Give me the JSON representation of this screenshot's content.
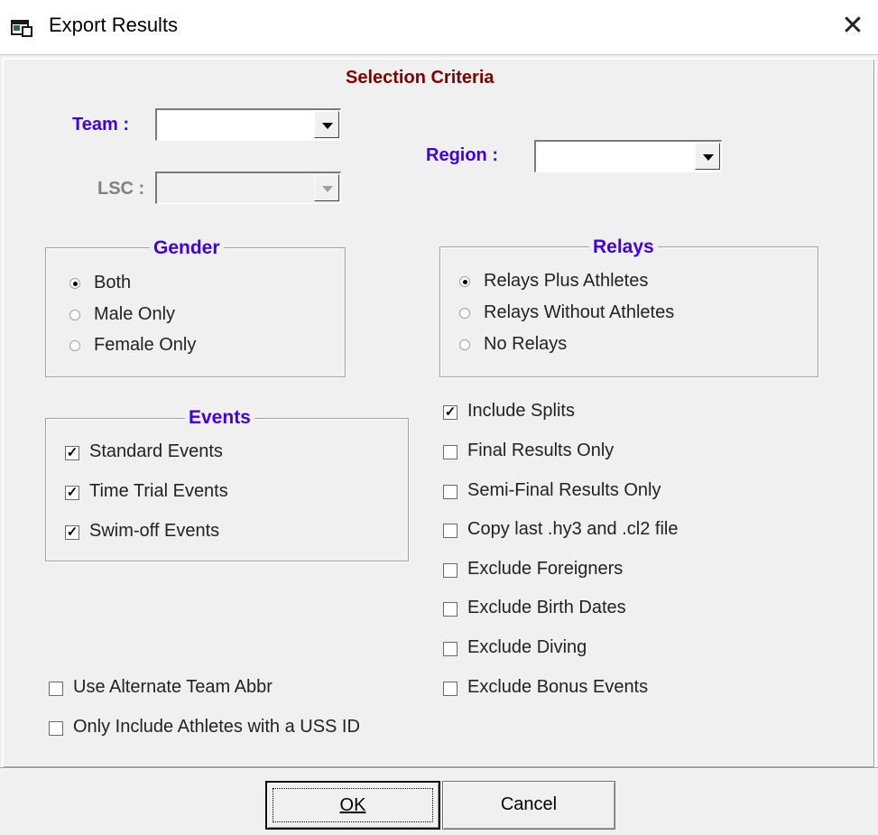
{
  "window": {
    "title": "Export Results",
    "close_icon": "close-icon",
    "app_icon": "app-icon"
  },
  "selection": {
    "heading": "Selection Criteria",
    "team_label": "Team :",
    "team_value": "",
    "lsc_label": "LSC :",
    "lsc_value": "",
    "region_label": "Region :",
    "region_value": ""
  },
  "gender": {
    "title": "Gender",
    "options": [
      {
        "label": "Both",
        "selected": true
      },
      {
        "label": "Male Only",
        "selected": false
      },
      {
        "label": "Female Only",
        "selected": false
      }
    ]
  },
  "relays": {
    "title": "Relays",
    "options": [
      {
        "label": "Relays Plus Athletes",
        "selected": true
      },
      {
        "label": "Relays Without Athletes",
        "selected": false
      },
      {
        "label": "No Relays",
        "selected": false
      }
    ]
  },
  "events": {
    "title": "Events",
    "options": [
      {
        "label": "Standard Events",
        "checked": true
      },
      {
        "label": "Time Trial Events",
        "checked": true
      },
      {
        "label": "Swim-off Events",
        "checked": true
      }
    ]
  },
  "options_right": [
    {
      "label": "Include Splits",
      "checked": true
    },
    {
      "label": "Final Results Only",
      "checked": false
    },
    {
      "label": "Semi-Final Results Only",
      "checked": false
    },
    {
      "label": "Copy last .hy3 and .cl2 file",
      "checked": false
    },
    {
      "label": "Exclude Foreigners",
      "checked": false
    },
    {
      "label": "Exclude Birth Dates",
      "checked": false
    },
    {
      "label": "Exclude Diving",
      "checked": false
    },
    {
      "label": "Exclude Bonus Events",
      "checked": false
    }
  ],
  "options_left": [
    {
      "label": "Use Alternate Team Abbr",
      "checked": false
    },
    {
      "label": "Only Include Athletes with a USS ID",
      "checked": false
    }
  ],
  "buttons": {
    "ok": "OK",
    "cancel": "Cancel"
  }
}
